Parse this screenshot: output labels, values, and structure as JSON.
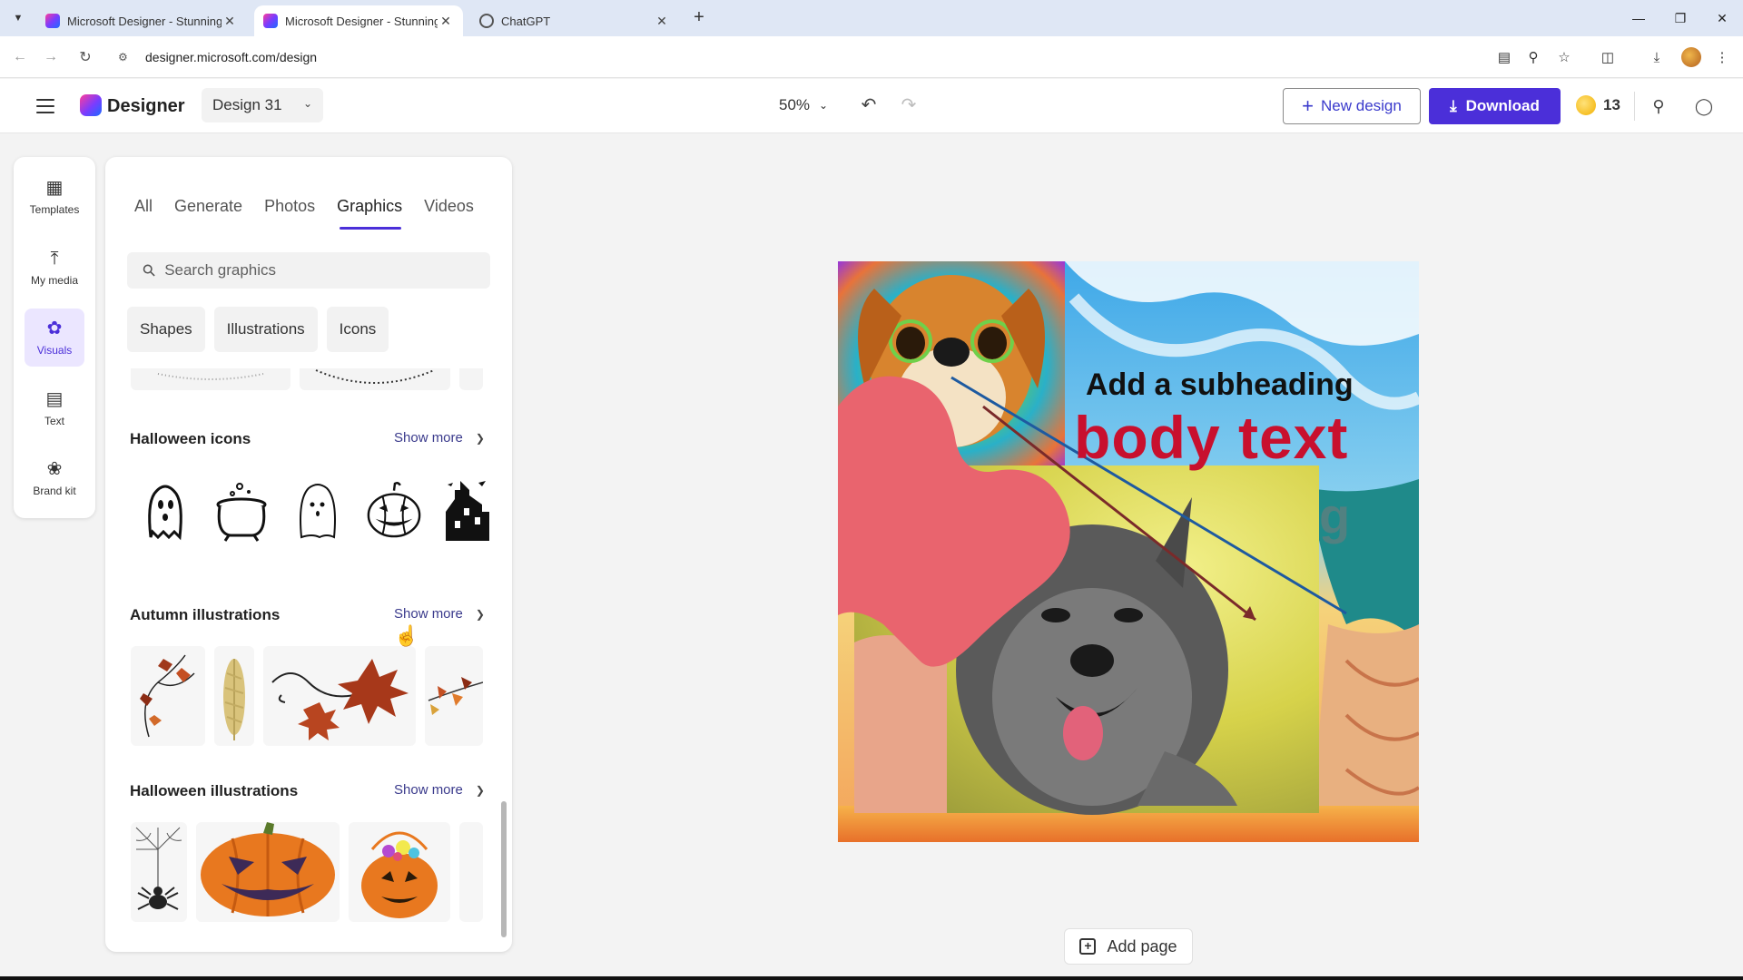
{
  "browser": {
    "tabs": [
      {
        "title": "Microsoft Designer - Stunning",
        "active": false
      },
      {
        "title": "Microsoft Designer - Stunning",
        "active": true
      },
      {
        "title": "ChatGPT",
        "active": false
      }
    ],
    "url": "designer.microsoft.com/design"
  },
  "header": {
    "brand": "Designer",
    "design_name": "Design 31",
    "zoom": "50%",
    "new_design_label": "New design",
    "download_label": "Download",
    "credits": "13"
  },
  "rail": {
    "items": [
      {
        "label": "Templates",
        "icon": "templates-icon",
        "active": false
      },
      {
        "label": "My media",
        "icon": "upload-icon",
        "active": false
      },
      {
        "label": "Visuals",
        "icon": "visuals-icon",
        "active": true
      },
      {
        "label": "Text",
        "icon": "text-icon",
        "active": false
      },
      {
        "label": "Brand kit",
        "icon": "palette-icon",
        "active": false
      }
    ]
  },
  "panel": {
    "tabs": [
      "All",
      "Generate",
      "Photos",
      "Graphics",
      "Videos"
    ],
    "active_tab": "Graphics",
    "search_placeholder": "Search graphics",
    "chips": [
      "Shapes",
      "Illustrations",
      "Icons"
    ],
    "sections": [
      {
        "title": "Halloween icons",
        "show_more": "Show more",
        "items": [
          "ghost-icon",
          "cauldron-icon",
          "ghost-outline-icon",
          "jack-o-lantern-icon",
          "haunted-house-icon"
        ]
      },
      {
        "title": "Autumn illustrations",
        "show_more": "Show more",
        "items": [
          "leaf-swirl-illustration",
          "wheat-illustration",
          "maple-leaf-illustration",
          "leaf-branch-illustration"
        ]
      },
      {
        "title": "Halloween illustrations",
        "show_more": "Show more",
        "items": [
          "spider-illustration",
          "pumpkin-illustration",
          "candy-bucket-illustration",
          "partial-illustration"
        ]
      }
    ]
  },
  "canvas": {
    "subheading": "Add a subheading",
    "body": "body text",
    "add_page_label": "Add page"
  },
  "colors": {
    "accent": "#4b2fd9",
    "body_text": "#c8102e",
    "blob": "#e9646e"
  }
}
